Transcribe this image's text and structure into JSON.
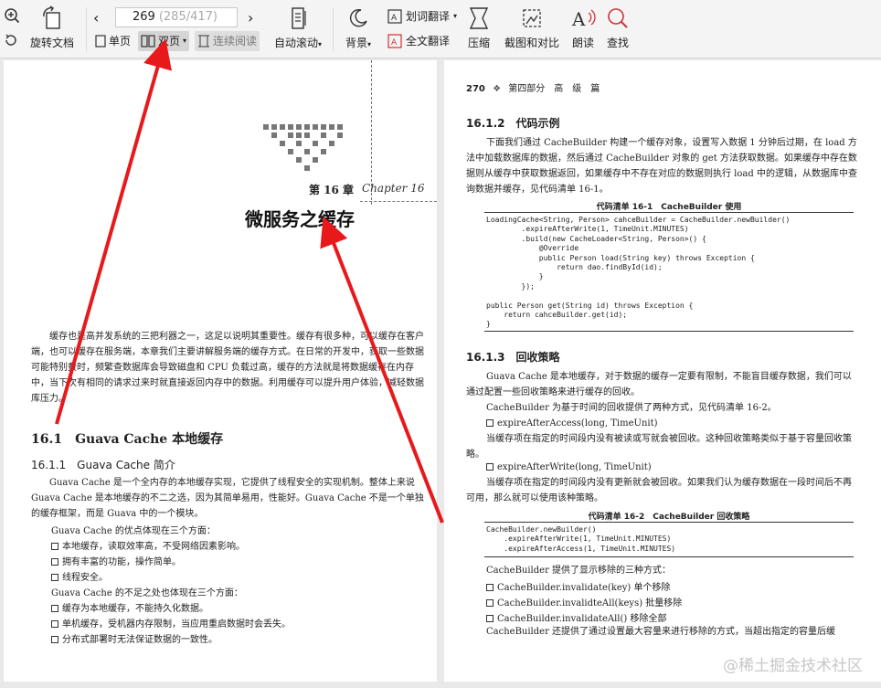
{
  "toolbar": {
    "rotate_label": "旋转文档",
    "page_current": "269",
    "page_total": "(285/417)",
    "single_page_label": "单页",
    "double_page_label": "双页",
    "continuous_label": "连续阅读",
    "auto_scroll_label": "自动滚动",
    "background_label": "背景",
    "word_translate_label": "划词翻译",
    "full_translate_label": "全文翻译",
    "compress_label": "压缩",
    "screenshot_label": "截图和对比",
    "read_aloud_label": "朗读",
    "find_label": "查找"
  },
  "left_page": {
    "chapter_number": "第 16 章",
    "chapter_script": "Chapter 16",
    "chapter_title": "微服务之缓存",
    "intro": "缓存也是高并发系统的三把利器之一，这足以说明其重要性。缓存有很多种，可以缓存在客户端，也可以缓存在服务端，本章我们主要讲解服务端的缓存方式。在日常的开发中，获取一些数据可能特别费时，频繁查数据库会导致磁盘和 CPU 负载过高，缓存的方法就是将数据缓存在内存中，当下次有相同的请求过来时就直接返回内存中的数据。利用缓存可以提升用户体验，减轻数据库压力。",
    "section_title": "16.1　Guava Cache 本地缓存",
    "subsection_title": "16.1.1　Guava Cache 简介",
    "guava_intro": "Guava Cache 是一个全内存的本地缓存实现，它提供了线程安全的实现机制。整体上来说 Guava Cache 是本地缓存的不二之选，因为其简单易用，性能好。Guava Cache 不是一个单独的缓存框架，而是 Guava 中的一个模块。",
    "advantages_head": "Guava Cache 的优点体现在三个方面：",
    "advantages": [
      "本地缓存，读取效率高，不受网络因素影响。",
      "拥有丰富的功能，操作简单。",
      "线程安全。"
    ],
    "disadvantages_head": "Guava Cache 的不足之处也体现在三个方面：",
    "disadvantages": [
      "缓存为本地缓存，不能持久化数据。",
      "单机缓存，受机器内存限制，当应用重启数据时会丢失。",
      "分布式部署时无法保证数据的一致性。"
    ]
  },
  "right_page": {
    "page_number": "270",
    "part_label": "第四部分　高　级　篇",
    "section_122": "16.1.2　代码示例",
    "para_122": "下面我们通过 CacheBuilder 构建一个缓存对象，设置写入数据 1 分钟后过期，在 load 方法中加载数据库的数据，然后通过 CacheBuilder 对象的 get 方法获取数据。如果缓存中存在数据则从缓存中获取数据返回，如果缓存中不存在对应的数据则执行 load 中的逻辑，从数据库中查询数据并缓存，见代码清单 16-1。",
    "listing1_caption": "代码清单 16-1　CacheBuilder 使用",
    "listing1_code": "LoadingCache<String, Person> cahceBuilder = CacheBuilder.newBuilder()\n        .expireAfterWrite(1, TimeUnit.MINUTES)\n        .build(new CacheLoader<String, Person>() {\n            @Override\n            public Person load(String key) throws Exception {\n                return dao.findById(id);\n            }\n        });\n\npublic Person get(String id) throws Exception {\n    return cahceBuilder.get(id);\n}",
    "section_123": "16.1.3　回收策略",
    "para_123a": "Guava Cache 是本地缓存，对于数据的缓存一定要有限制，不能盲目缓存数据，我们可以通过配置一些回收策略来进行缓存的回收。",
    "para_123b": "CacheBuilder 为基于时间的回收提供了两种方式，见代码清单 16-2。",
    "item_access": "expireAfterAccess(long, TimeUnit)",
    "para_access": "当缓存项在指定的时间段内没有被读或写就会被回收。这种回收策略类似于基于容量回收策略。",
    "item_write": "expireAfterWrite(long, TimeUnit)",
    "para_write": "当缓存项在指定的时间段内没有更新就会被回收。如果我们认为缓存数据在一段时间后不再可用，那么就可以使用该种策略。",
    "listing2_caption": "代码清单 16-2　CacheBuilder 回收策略",
    "listing2_code": "CacheBuilder.newBuilder()\n    .expireAfterWrite(1, TimeUnit.MINUTES)\n    .expireAfterAccess(1, TimeUnit.MINUTES)",
    "remove_head": "CacheBuilder 提供了显示移除的三种方式：",
    "removals": [
      "CacheBuilder.invalidate(key) 单个移除",
      "CacheBuilder.invalidteAll(keys) 批量移除",
      "CacheBuilder.invalidateAll() 移除全部"
    ],
    "para_last": "CacheBuilder 还提供了通过设置最大容量来进行移除的方式，当超出指定的容量后缓"
  },
  "watermark": "@稀土掘金技术社区",
  "colors": {
    "arrow": "#e8191b",
    "toolbar_bg": "#f4f4f4"
  }
}
